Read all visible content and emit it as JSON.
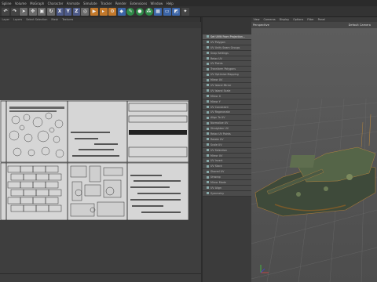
{
  "menubar": [
    "Spline",
    "Volume",
    "MoGraph",
    "Character",
    "Animate",
    "Simulate",
    "Tracker",
    "Render",
    "Extensions",
    "Window",
    "Help"
  ],
  "toolbar": {
    "icons": [
      "undo-icon",
      "redo-icon",
      "select-icon",
      "move-icon",
      "scale-icon",
      "rotate-icon",
      "x-axis-icon",
      "y-axis-icon",
      "z-axis-icon",
      "world-icon",
      "render-icon",
      "render-view-icon",
      "render-settings-icon",
      "cube-icon",
      "spline-pen-icon",
      "subdivision-icon",
      "array-icon",
      "scene-icon",
      "camera-icon",
      "deformer-icon",
      "light-icon"
    ]
  },
  "uv_editor": {
    "menu": [
      "Layer",
      "Layers",
      "Select Selection",
      "Mask",
      "Textures"
    ]
  },
  "object_manager": {
    "items": [
      "Set UVW From Projection...",
      "UV Polygon",
      "UV Unify Seam Groups",
      "Snap Settings",
      "Relax UV",
      "UV Points",
      "Transform Polygons",
      "UV Optimize Mapping",
      "Mirror UV",
      "UV Island Mirror",
      "UV Island Scale",
      "Mirror X",
      "Mirror Y",
      "UV Constraint",
      "UV Regenerate",
      "Align To UV",
      "Normalize UV",
      "Straighten UV",
      "Relax UV Points",
      "Rotate UV",
      "Scale UV",
      "UV Selection",
      "Mirror UV",
      "UV Invert",
      "UV Stack",
      "Shared UV",
      "Unwrap",
      "Mirror Mode",
      "UV Align",
      "Symmetry"
    ]
  },
  "viewport": {
    "menu": [
      "View",
      "Cameras",
      "Display",
      "Options",
      "Filter",
      "Panel"
    ],
    "view_name": "Perspective",
    "camera_name": "Default Camera"
  }
}
